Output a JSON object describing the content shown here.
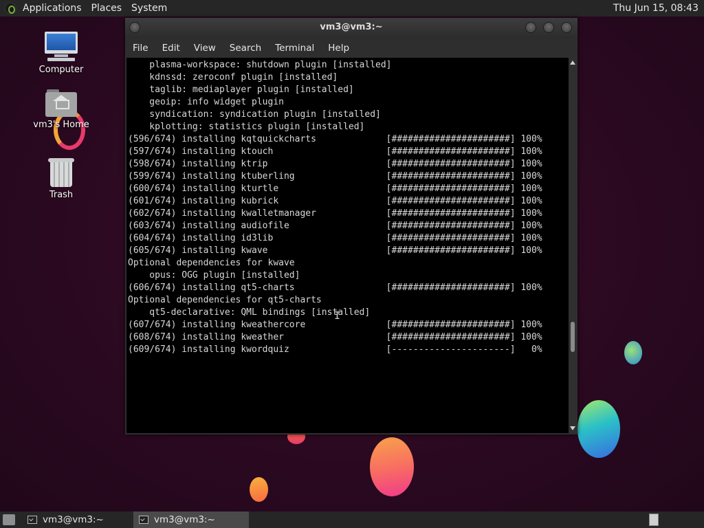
{
  "top_panel": {
    "menus": [
      "Applications",
      "Places",
      "System"
    ],
    "clock": "Thu Jun 15, 08:43"
  },
  "desktop_icons": [
    {
      "label": "Computer",
      "icon": "computer-icon"
    },
    {
      "label": "vm3's Home",
      "icon": "home-folder-icon"
    },
    {
      "label": "Trash",
      "icon": "trash-icon"
    }
  ],
  "terminal": {
    "title": "vm3@vm3:~",
    "menus": [
      "File",
      "Edit",
      "View",
      "Search",
      "Terminal",
      "Help"
    ],
    "lines": [
      "    plasma-workspace: shutdown plugin [installed]",
      "    kdnssd: zeroconf plugin [installed]",
      "    taglib: mediaplayer plugin [installed]",
      "    geoip: info widget plugin",
      "    syndication: syndication plugin [installed]",
      "    kplotting: statistics plugin [installed]",
      "(596/674) installing kqtquickcharts             [######################] 100%",
      "(597/674) installing ktouch                     [######################] 100%",
      "(598/674) installing ktrip                      [######################] 100%",
      "(599/674) installing ktuberling                 [######################] 100%",
      "(600/674) installing kturtle                    [######################] 100%",
      "(601/674) installing kubrick                    [######################] 100%",
      "(602/674) installing kwalletmanager             [######################] 100%",
      "(603/674) installing audiofile                  [######################] 100%",
      "(604/674) installing id3lib                     [######################] 100%",
      "(605/674) installing kwave                      [######################] 100%",
      "Optional dependencies for kwave",
      "    opus: OGG plugin [installed]",
      "(606/674) installing qt5-charts                 [######################] 100%",
      "Optional dependencies for qt5-charts",
      "    qt5-declarative: QML bindings [installed]",
      "(607/674) installing kweathercore               [######################] 100%",
      "(608/674) installing kweather                   [######################] 100%",
      "(609/674) installing kwordquiz                  [----------------------]   0%"
    ]
  },
  "taskbar": {
    "tasks": [
      "vm3@vm3:~",
      "vm3@vm3:~"
    ]
  },
  "colors": {
    "desktop_bg": "#2a0920",
    "panel_bg": "#262626",
    "terminal_bg": "#000000",
    "terminal_fg": "#d8d8d8"
  }
}
